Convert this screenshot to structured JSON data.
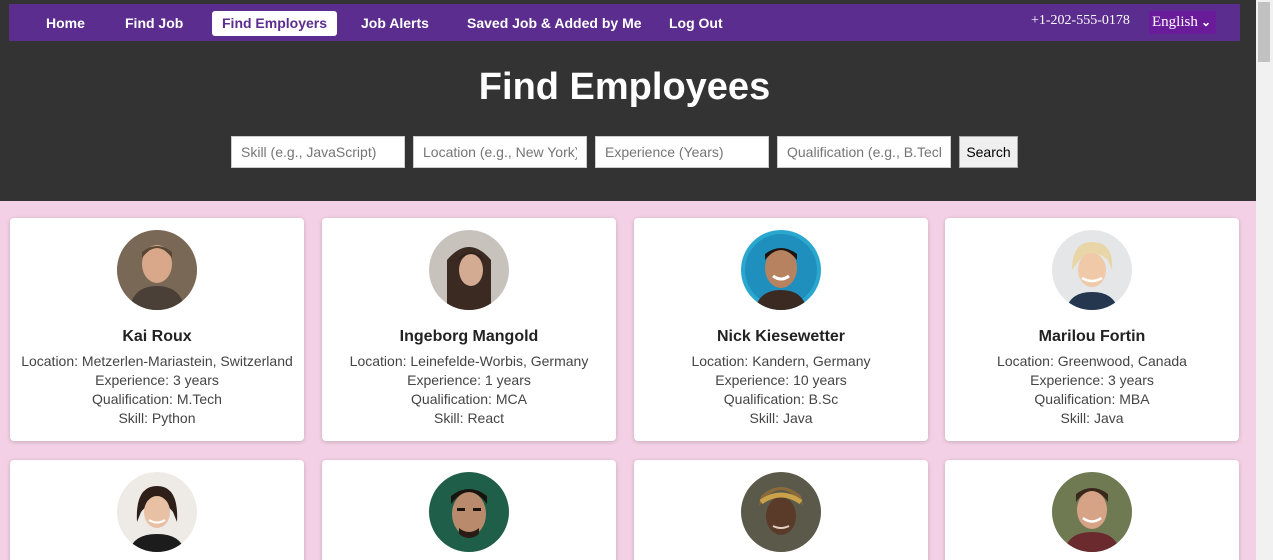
{
  "nav": {
    "items": [
      {
        "label": "Home",
        "active": false
      },
      {
        "label": "Find Job",
        "active": false
      },
      {
        "label": "Find Employers",
        "active": true
      },
      {
        "label": "Job Alerts",
        "active": false
      },
      {
        "label": "Saved Job & Added by Me",
        "active": false
      },
      {
        "label": "Log Out",
        "active": false
      }
    ],
    "phone": "+1-202-555-0178",
    "language": "English"
  },
  "page": {
    "title": "Find Employees"
  },
  "search": {
    "skill_placeholder": "Skill (e.g., JavaScript)",
    "location_placeholder": "Location (e.g., New York)",
    "experience_placeholder": "Experience (Years)",
    "qualification_placeholder": "Qualification (e.g., B.Tech)",
    "button_label": "Search"
  },
  "labels": {
    "location": "Location:",
    "experience": "Experience:",
    "qualification": "Qualification:",
    "skill": "Skill:"
  },
  "candidates": [
    {
      "name": "Kai Roux",
      "location": "Metzerlen-Mariastein, Switzerland",
      "experience": "3 years",
      "qualification": "M.Tech",
      "skill": "Python"
    },
    {
      "name": "Ingeborg Mangold",
      "location": "Leinefelde-Worbis, Germany",
      "experience": "1 years",
      "qualification": "MCA",
      "skill": "React"
    },
    {
      "name": "Nick Kiesewetter",
      "location": "Kandern, Germany",
      "experience": "10 years",
      "qualification": "B.Sc",
      "skill": "Java"
    },
    {
      "name": "Marilou Fortin",
      "location": "Greenwood, Canada",
      "experience": "3 years",
      "qualification": "MBA",
      "skill": "Java"
    }
  ],
  "colors": {
    "nav_bg": "#5b2d8e",
    "header_bg": "#333333",
    "page_bg": "#f3d0e5",
    "language_bg": "#6a1b9a"
  },
  "icons": {
    "language_dropdown": "chevron-down-icon"
  }
}
